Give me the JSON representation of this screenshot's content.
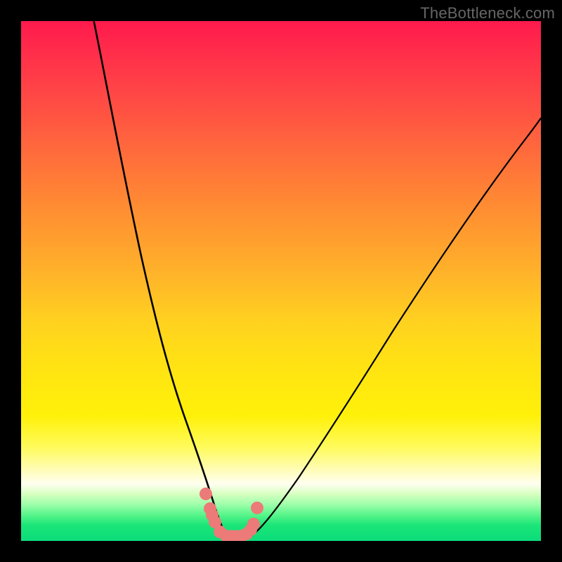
{
  "watermark": "TheBottleneck.com",
  "colors": {
    "frame": "#000000",
    "curve_stroke": "#000000",
    "marker_fill": "#ec7a78",
    "marker_stroke": "#ec7a78"
  },
  "chart_data": {
    "type": "line",
    "title": "",
    "xlabel": "",
    "ylabel": "",
    "xlim": [
      0,
      100
    ],
    "ylim": [
      0,
      100
    ],
    "grid": false,
    "legend": false,
    "note": "Axes have no tick labels; values below are estimated from visual geometry (0–100 scale matching the plot box).",
    "series": [
      {
        "name": "left-curve",
        "style": "line",
        "x": [
          14,
          18,
          22,
          25,
          27,
          29,
          31,
          33,
          34.5,
          36,
          37,
          38,
          39
        ],
        "y": [
          100,
          80,
          58,
          43,
          34,
          26,
          19,
          12,
          8,
          4.5,
          2.5,
          1,
          0.5
        ]
      },
      {
        "name": "right-curve",
        "style": "line",
        "x": [
          44,
          47,
          51,
          56,
          62,
          69,
          77,
          86,
          95,
          100
        ],
        "y": [
          0.5,
          3,
          8,
          15,
          24,
          35,
          48,
          62,
          75,
          82
        ]
      },
      {
        "name": "bottom-markers",
        "style": "scatter",
        "marker_radius_px": 8,
        "x": [
          35.5,
          36.4,
          36.8,
          37.3,
          38.2,
          39.4,
          40.5,
          41.4,
          42.4,
          43.4,
          44.2,
          44.7,
          45.4
        ],
        "y": [
          9.1,
          6.2,
          5.0,
          3.6,
          1.8,
          1.0,
          0.9,
          0.9,
          0.95,
          1.3,
          2.2,
          3.2,
          6.4
        ]
      }
    ]
  }
}
